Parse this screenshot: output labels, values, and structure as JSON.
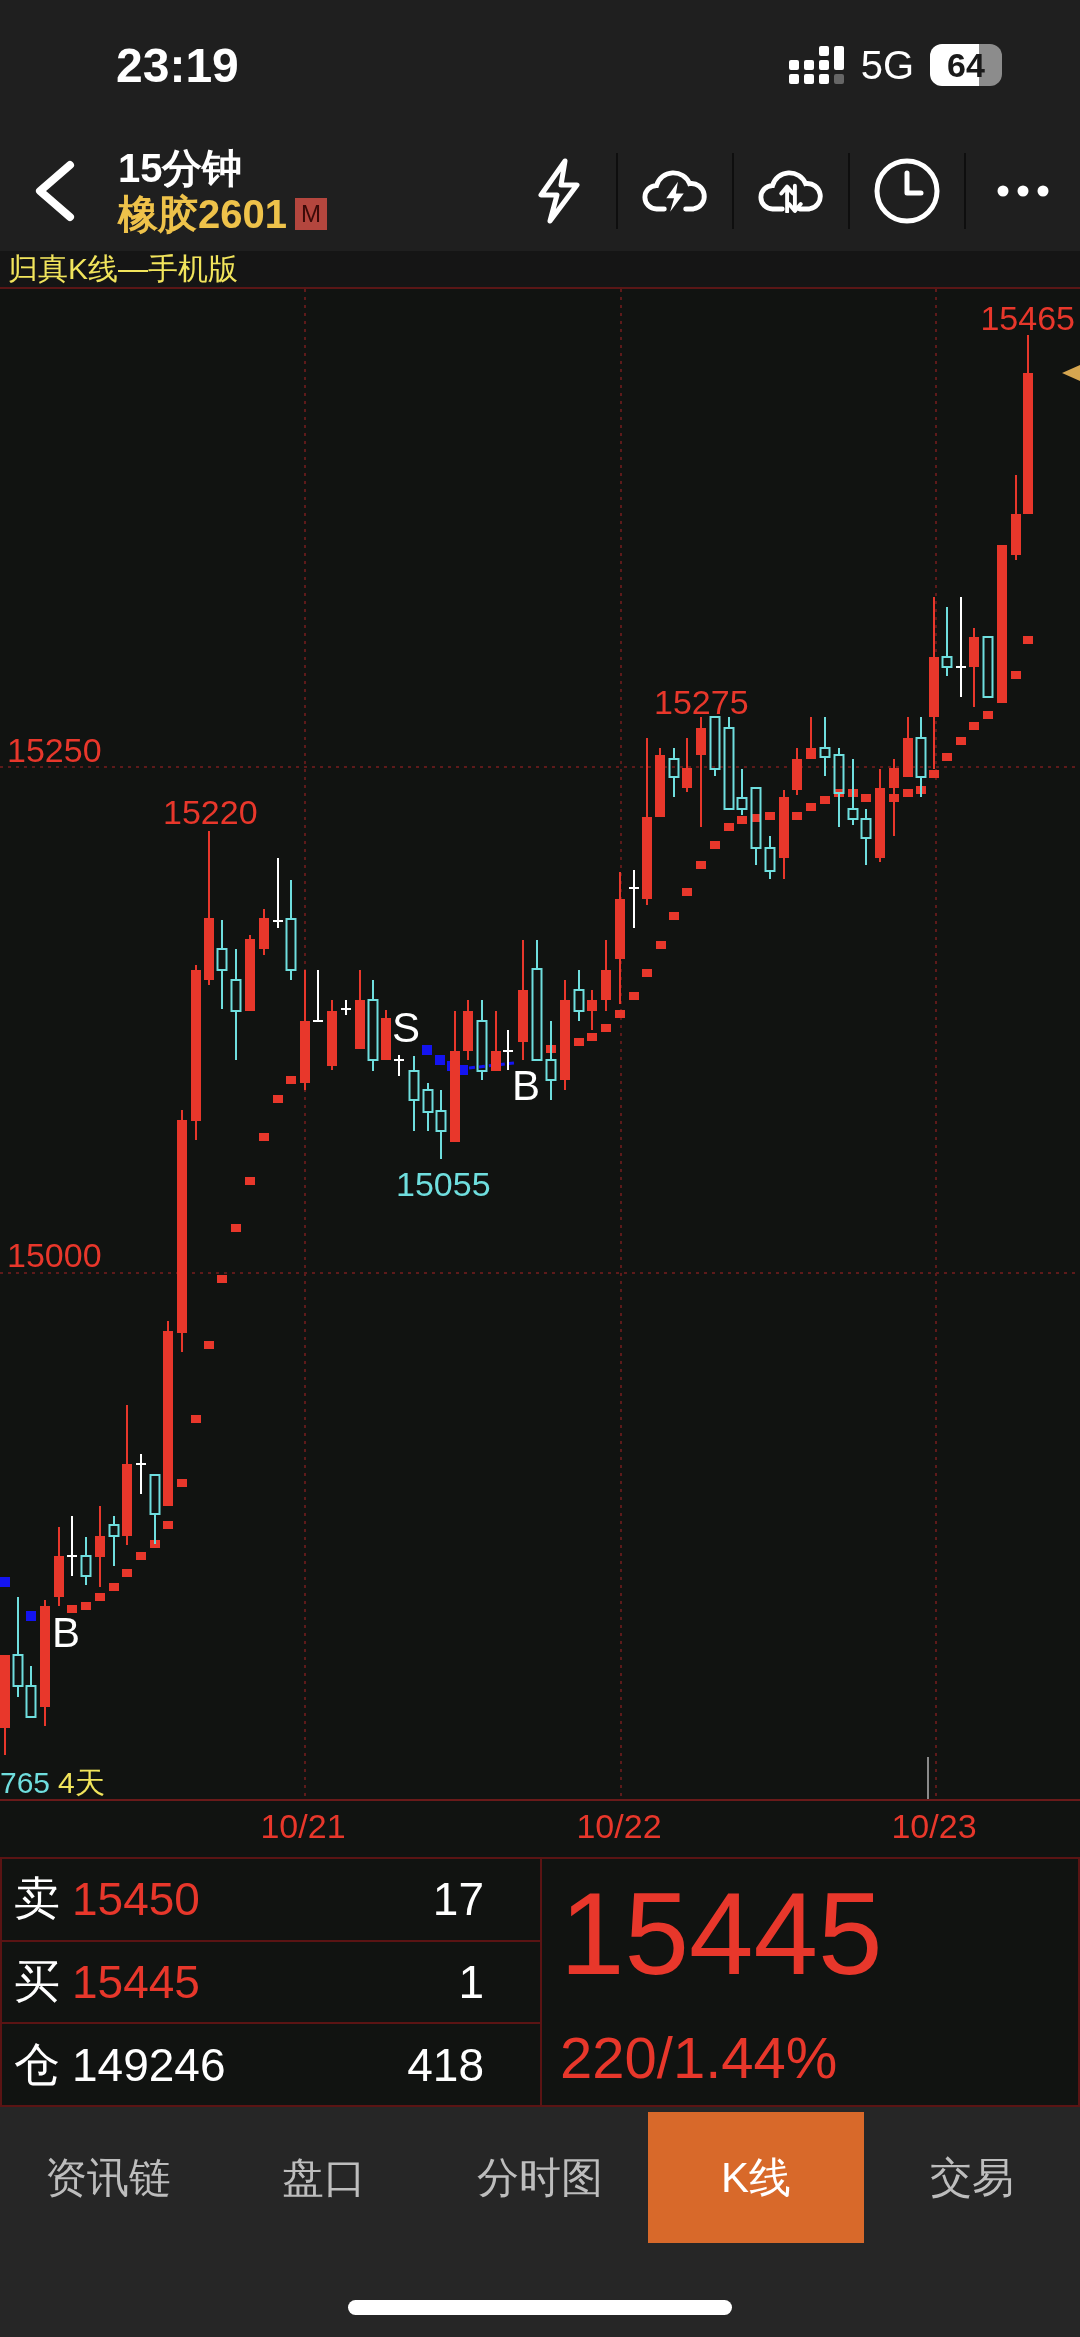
{
  "status_bar": {
    "time": "23:19",
    "network": "5G",
    "battery": "64"
  },
  "header": {
    "period": "15分钟",
    "symbol": "橡胶2601",
    "badge": "M"
  },
  "indicator_title": "归真K线—手机版",
  "chart": {
    "price_labels": [
      "15250",
      "15000"
    ],
    "annotations": [
      {
        "text": "15465",
        "kind": "high"
      },
      {
        "text": "15275",
        "kind": "high"
      },
      {
        "text": "15220",
        "kind": "high"
      },
      {
        "text": "15055",
        "kind": "low"
      }
    ],
    "signals": [
      "S",
      "B",
      "B"
    ],
    "corner_labels": [
      {
        "text": "765",
        "color": "#6fdede"
      },
      {
        "text": "4天",
        "color": "#f2e55c"
      }
    ],
    "dates": [
      "10/21",
      "10/22",
      "10/23"
    ]
  },
  "quote": {
    "rows": [
      {
        "label": "卖",
        "price": "15450",
        "volume": "17",
        "kind": "ask"
      },
      {
        "label": "买",
        "price": "15445",
        "volume": "1",
        "kind": "bid"
      },
      {
        "label": "仓",
        "price": "149246",
        "volume": "418",
        "kind": "open_interest"
      }
    ],
    "last_price": "15445",
    "change": "220/1.44%"
  },
  "tabs": [
    {
      "label": "资讯链",
      "selected": false
    },
    {
      "label": "盘口",
      "selected": false
    },
    {
      "label": "分时图",
      "selected": false
    },
    {
      "label": "K线",
      "selected": true
    },
    {
      "label": "交易",
      "selected": false
    }
  ]
}
